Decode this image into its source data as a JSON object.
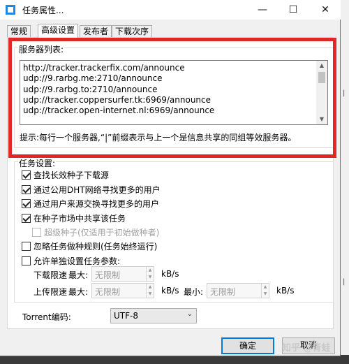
{
  "window": {
    "title": "任务属性...",
    "minimize": "—",
    "maximize": "☐",
    "close": "✕"
  },
  "tabs": [
    {
      "label": "常规",
      "active": false
    },
    {
      "label": "高级设置",
      "active": true
    },
    {
      "label": "发布者",
      "active": false
    },
    {
      "label": "下载次序",
      "active": false
    }
  ],
  "servers": {
    "group_label": "服务器列表:",
    "lines": [
      "http://tracker.trackerfix.com/announce",
      "udp://9.rarbg.me:2710/announce",
      "udp://9.rarbg.to:2710/announce",
      "udp://tracker.coppersurfer.tk:6969/announce",
      "udp://tracker.open-internet.nl:6969/announce"
    ],
    "hint": "提示:每行一个服务器,“|”前缀表示与上一个是信息共享的同组等效服务器。"
  },
  "task_settings": {
    "group_label": "任务设置:",
    "options": [
      {
        "label": "查找长效种子下载源",
        "checked": true,
        "disabled": false,
        "indent": 0
      },
      {
        "label": "通过公用DHT网络寻找更多的用户",
        "checked": true,
        "disabled": false,
        "indent": 0
      },
      {
        "label": "通过用户来源交换寻找更多的用户",
        "checked": true,
        "disabled": false,
        "indent": 0
      },
      {
        "label": "在种子市场中共享该任务",
        "checked": true,
        "disabled": false,
        "indent": 0
      },
      {
        "label": "超级种子(仅适用于初始做种者)",
        "checked": false,
        "disabled": true,
        "indent": 1
      },
      {
        "label": "忽略任务做种规则(任务始终运行)",
        "checked": false,
        "disabled": false,
        "indent": 0
      },
      {
        "label": "允许单独设置任务参数:",
        "checked": false,
        "disabled": false,
        "indent": 0
      }
    ],
    "download_limit": {
      "label": "下载限速",
      "max_label": "最大:",
      "value": "无限制",
      "unit": "kB/s"
    },
    "upload_limit": {
      "label": "上传限速",
      "max_label": "最大:",
      "max_value": "无限制",
      "max_unit": "kB/s",
      "min_label": "最小:",
      "min_value": "无限制",
      "min_unit": "kB/s"
    }
  },
  "encoding": {
    "label": "Torrent编码:",
    "value": "UTF-8"
  },
  "buttons": {
    "ok": "确定",
    "cancel": "取消"
  },
  "watermark": "知乎 @青蛙"
}
